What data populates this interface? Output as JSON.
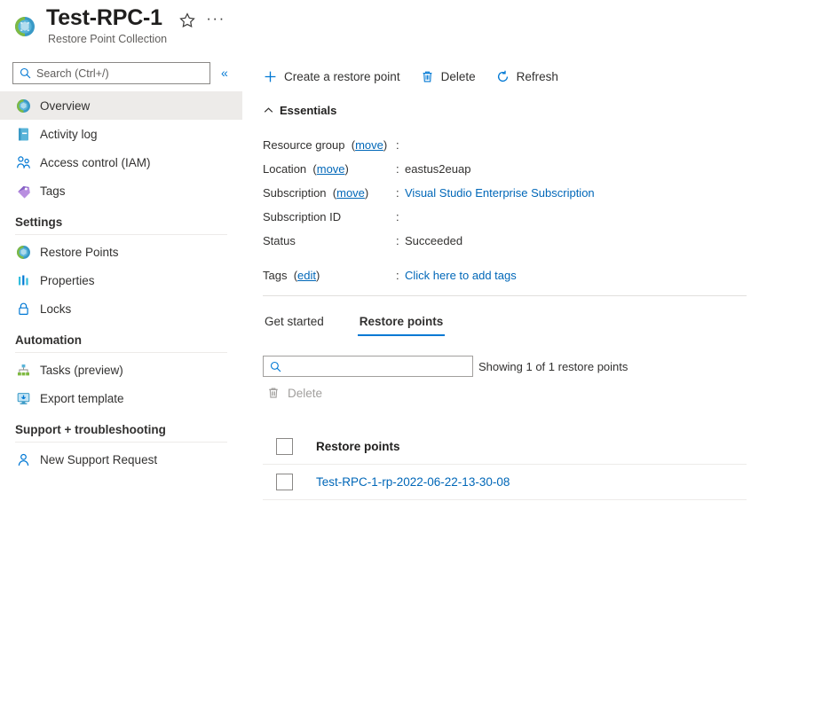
{
  "header": {
    "title": "Test-RPC-1",
    "subtitle": "Restore Point Collection",
    "icon": "restore-point-collection-icon",
    "favorite_icon": "star-outline-icon",
    "more_icon": "ellipsis-icon"
  },
  "search": {
    "placeholder": "Search (Ctrl+/)",
    "value": "",
    "icon": "search-icon",
    "collapse_icon": "chevron-double-left-icon"
  },
  "sidebar": {
    "items": [
      {
        "label": "Overview",
        "icon": "globe-icon",
        "selected": true
      },
      {
        "label": "Activity log",
        "icon": "activity-log-icon",
        "selected": false
      },
      {
        "label": "Access control (IAM)",
        "icon": "people-icon",
        "selected": false
      },
      {
        "label": "Tags",
        "icon": "tag-icon",
        "selected": false
      }
    ],
    "groups": [
      {
        "title": "Settings",
        "items": [
          {
            "label": "Restore Points",
            "icon": "globe-icon"
          },
          {
            "label": "Properties",
            "icon": "properties-bars-icon"
          },
          {
            "label": "Locks",
            "icon": "lock-icon"
          }
        ]
      },
      {
        "title": "Automation",
        "items": [
          {
            "label": "Tasks (preview)",
            "icon": "tasks-hierarchy-icon"
          },
          {
            "label": "Export template",
            "icon": "export-template-icon"
          }
        ]
      },
      {
        "title": "Support + troubleshooting",
        "items": [
          {
            "label": "New Support Request",
            "icon": "support-person-icon"
          }
        ]
      }
    ]
  },
  "command_bar": {
    "buttons": [
      {
        "label": "Create a restore point",
        "icon": "plus-icon"
      },
      {
        "label": "Delete",
        "icon": "trash-icon"
      },
      {
        "label": "Refresh",
        "icon": "refresh-icon"
      }
    ]
  },
  "essentials": {
    "title": "Essentials",
    "collapse_icon": "chevron-up-icon",
    "rows": [
      {
        "key": "Resource group",
        "key_link": "move",
        "value": "",
        "redacted": true,
        "is_link": false
      },
      {
        "key": "Location",
        "key_link": "move",
        "value": "eastus2euap",
        "redacted": false,
        "is_link": false
      },
      {
        "key": "Subscription",
        "key_link": "move",
        "value": "Visual Studio Enterprise Subscription",
        "redacted": false,
        "is_link": true
      },
      {
        "key": "Subscription ID",
        "key_link": "",
        "value": "",
        "redacted": true,
        "is_link": false
      },
      {
        "key": "Status",
        "key_link": "",
        "value": "Succeeded",
        "redacted": false,
        "is_link": false
      }
    ],
    "tags_row": {
      "key": "Tags",
      "key_link": "edit",
      "value": "Click here to add tags",
      "is_link": true
    }
  },
  "tabs": [
    {
      "label": "Get started",
      "active": false
    },
    {
      "label": "Restore points",
      "active": true
    }
  ],
  "list": {
    "search_placeholder": "",
    "search_value": "",
    "search_icon": "search-icon",
    "showing_text": "Showing 1 of 1 restore points",
    "delete_label": "Delete",
    "delete_icon": "trash-icon",
    "delete_disabled": true,
    "column_header": "Restore points",
    "rows": [
      {
        "name": "Test-RPC-1-rp-2022-06-22-13-30-08"
      }
    ]
  },
  "colors": {
    "accent": "#0078d4",
    "link": "#0067b8",
    "selected_bg": "#edebe9",
    "text": "#323130",
    "disabled": "#a19f9d"
  }
}
